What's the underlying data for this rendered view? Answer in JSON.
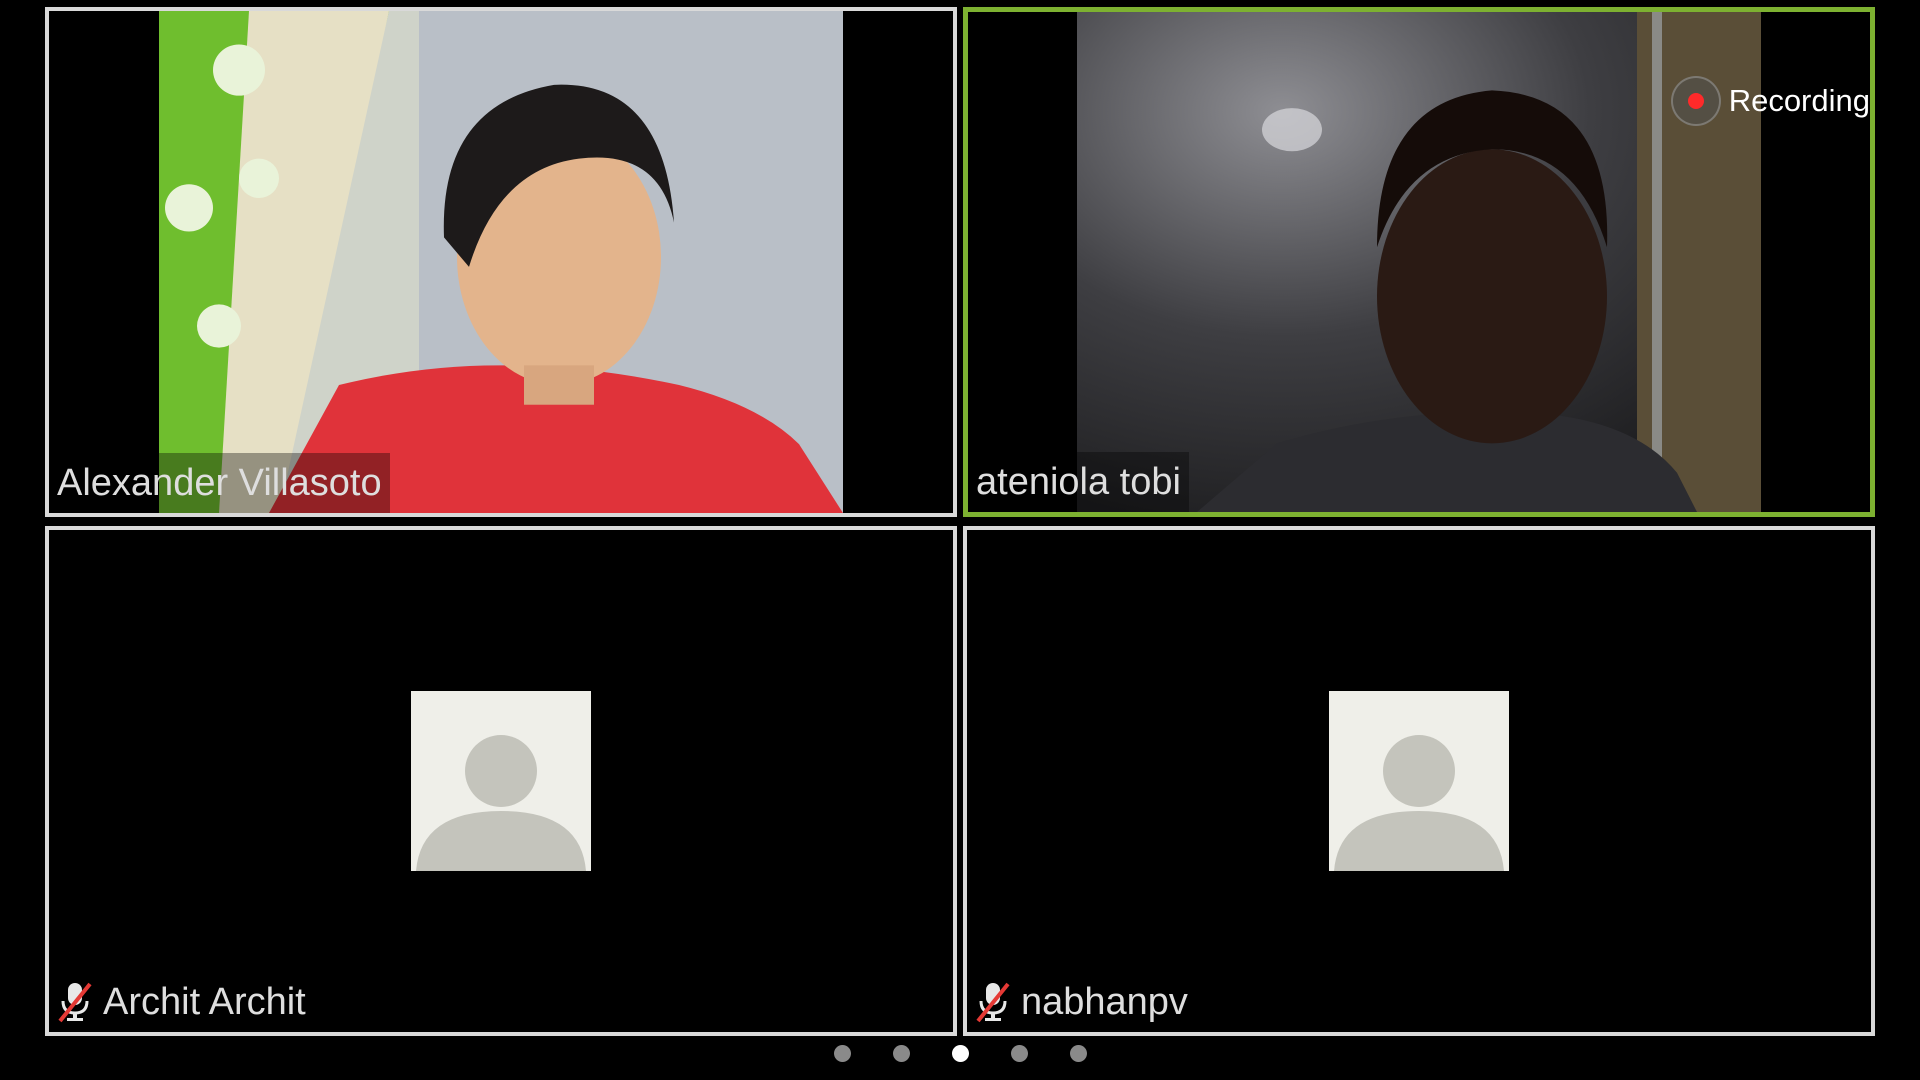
{
  "recording": {
    "label": "Recording",
    "dot_color": "#ff2a2a"
  },
  "participants": [
    {
      "name": "Alexander Villasoto",
      "video": true,
      "muted": false,
      "active_speaker": false
    },
    {
      "name": "ateniola tobi",
      "video": true,
      "muted": false,
      "active_speaker": true
    },
    {
      "name": "Archit Archit",
      "video": false,
      "muted": true,
      "active_speaker": false
    },
    {
      "name": "nabhanpv",
      "video": false,
      "muted": true,
      "active_speaker": false
    }
  ],
  "pager": {
    "total": 5,
    "current": 3
  },
  "colors": {
    "active_speaker_border": "#7db131",
    "tile_border": "#d9d9d9",
    "avatar_background": "#efefe9",
    "avatar_silhouette": "#c4c4bc"
  },
  "icons": {
    "muted": "microphone-muted-icon",
    "recording": "recording-dot-icon",
    "avatar": "default-avatar-icon"
  }
}
